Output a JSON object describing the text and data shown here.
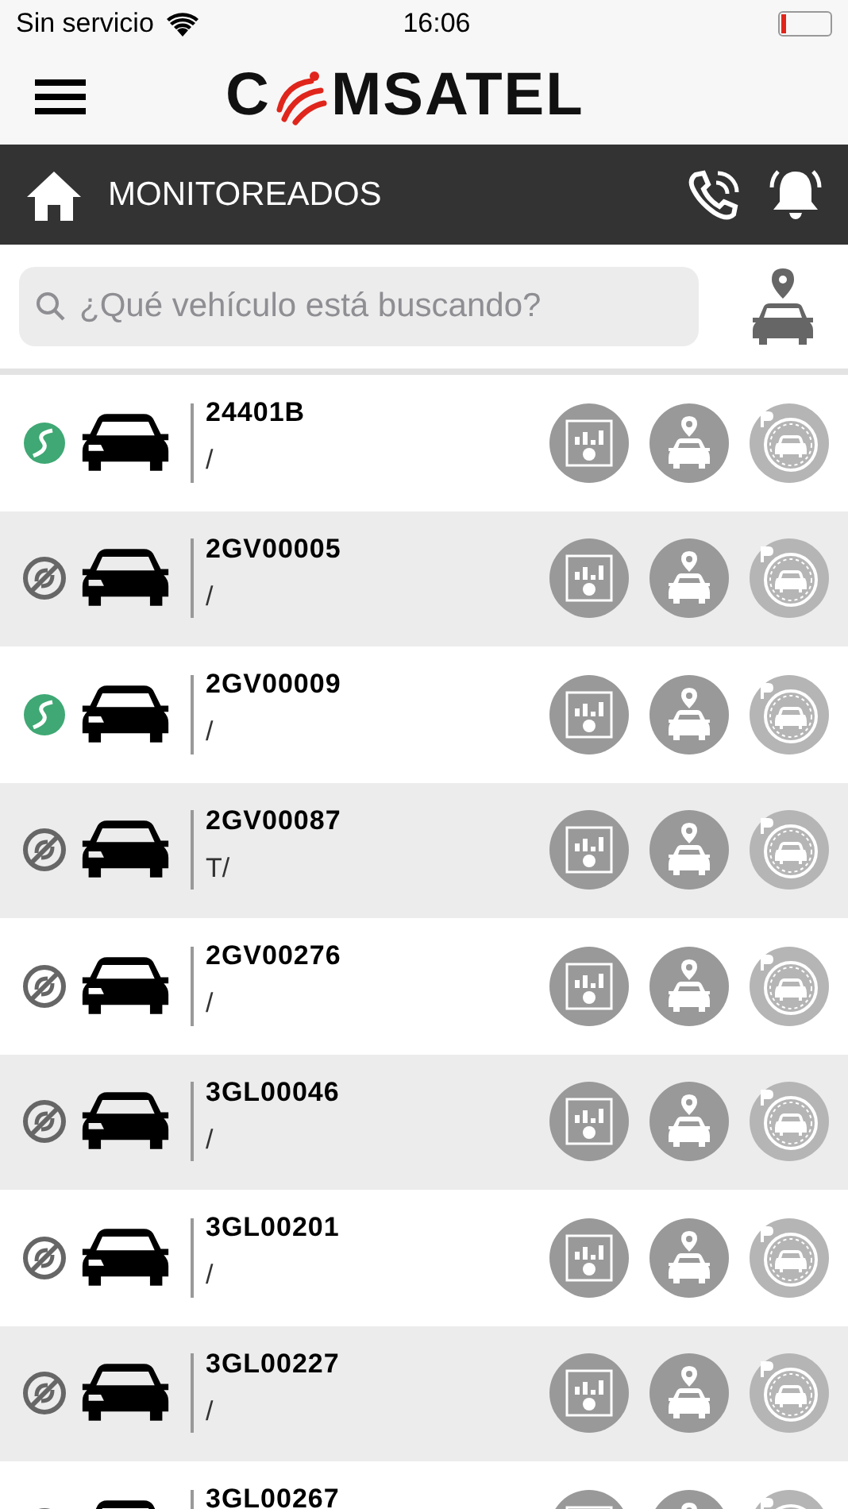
{
  "status_bar": {
    "carrier": "Sin servicio",
    "time": "16:06",
    "battery": {
      "level": 0.1
    }
  },
  "header": {
    "logo": {
      "start": "C",
      "end": "MSATEL"
    }
  },
  "title_bar": {
    "title": "MONITOREADOS"
  },
  "search": {
    "placeholder": "¿Qué vehículo está buscando?"
  },
  "vehicles": [
    {
      "plate": "24401B",
      "detail": "/",
      "online": true
    },
    {
      "plate": "2GV00005",
      "detail": "/",
      "online": false
    },
    {
      "plate": "2GV00009",
      "detail": "/",
      "online": true
    },
    {
      "plate": "2GV00087",
      "detail": "T/",
      "online": false
    },
    {
      "plate": "2GV00276",
      "detail": "/",
      "online": false
    },
    {
      "plate": "3GL00046",
      "detail": "/",
      "online": false
    },
    {
      "plate": "3GL00201",
      "detail": "/",
      "online": false
    },
    {
      "plate": "3GL00227",
      "detail": "/",
      "online": false
    },
    {
      "plate": "3GL00267",
      "online": false
    }
  ]
}
